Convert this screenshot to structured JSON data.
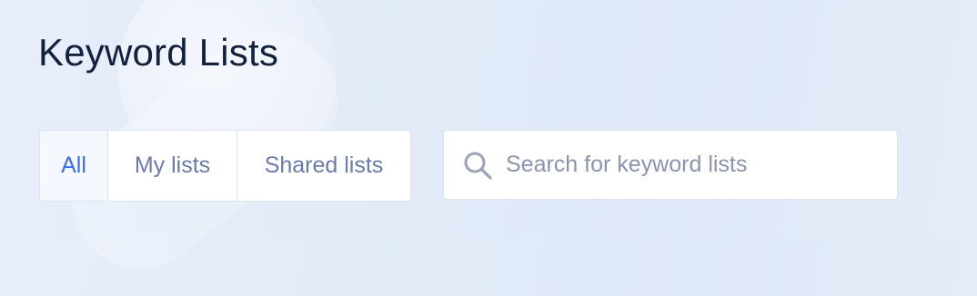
{
  "page": {
    "title": "Keyword Lists"
  },
  "filter_tabs": [
    {
      "label": "All",
      "active": true
    },
    {
      "label": "My lists",
      "active": false
    },
    {
      "label": "Shared lists",
      "active": false
    }
  ],
  "search": {
    "value": "",
    "placeholder": "Search for keyword lists",
    "icon": "search-icon"
  },
  "colors": {
    "title": "#14213d",
    "active_tab": "#3b6cf0",
    "inactive_tab": "#6b7ba8",
    "placeholder": "#8a94ad"
  }
}
